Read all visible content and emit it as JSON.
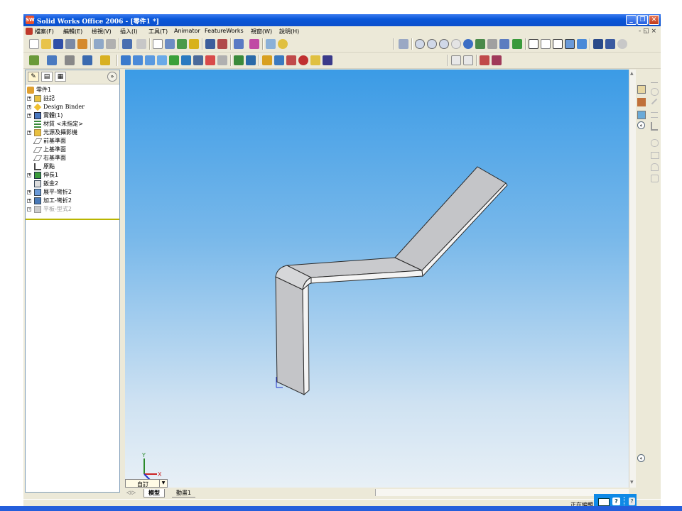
{
  "window": {
    "title": "Solid Works Office 2006 - [零件1 *]",
    "app_icon": "SW",
    "controls": {
      "minimize": "_",
      "restore": "❐",
      "close": "✕"
    },
    "doc_controls": "- ◱ ×"
  },
  "menu": {
    "items": [
      "檔案(F)",
      "編輯(E)",
      "檢視(V)",
      "插入(I)",
      "工具(T)",
      "Animator",
      "FeatureWorks",
      "視窗(W)",
      "說明(H)"
    ]
  },
  "feature_manager": {
    "tabs": [
      "feature-tree-tab-icon",
      "property-tab-icon",
      "config-tab-icon"
    ],
    "expand": "»",
    "root": "零件1",
    "items": [
      {
        "label": "註記",
        "expander": "+",
        "icon": "annotation-icon"
      },
      {
        "label": "Design Binder",
        "expander": "+",
        "icon": "binder-icon"
      },
      {
        "label": "實體(1)",
        "expander": "+",
        "icon": "solid-bodies-icon"
      },
      {
        "label": "材質 <未指定>",
        "expander": "",
        "icon": "material-icon"
      },
      {
        "label": "光源及攝影機",
        "expander": "+",
        "icon": "lights-icon"
      },
      {
        "label": "前基準面",
        "expander": "",
        "icon": "plane-icon"
      },
      {
        "label": "上基準面",
        "expander": "",
        "icon": "plane-icon"
      },
      {
        "label": "右基準面",
        "expander": "",
        "icon": "plane-icon"
      },
      {
        "label": "原點",
        "expander": "",
        "icon": "origin-icon"
      },
      {
        "label": "伸長1",
        "expander": "+",
        "icon": "extrude-icon"
      },
      {
        "label": "鈑金2",
        "expander": "",
        "icon": "sheetmetal-icon"
      },
      {
        "label": "展平-彎折2",
        "expander": "+",
        "icon": "flatten-bends-icon"
      },
      {
        "label": "加工-彎折2",
        "expander": "+",
        "icon": "process-bends-icon"
      },
      {
        "label": "平板-型式2",
        "expander": "+",
        "icon": "flat-pattern-icon",
        "suppressed": true
      }
    ]
  },
  "viewport": {
    "view_label": "自訂",
    "triad": {
      "x": "X",
      "y": "Y",
      "z": "Z"
    },
    "gradient_top": "#3b9be6",
    "gradient_bottom": "#e8f0f6"
  },
  "bottom_tabs": {
    "nav": "◁ ▷",
    "tabs": [
      "模型",
      "動畫1"
    ]
  },
  "status": {
    "text": "正在編輯"
  },
  "tray": {
    "help": "?"
  },
  "colors": {
    "title_bar": "#0a57d8",
    "panel": "#ece9d8",
    "part_face": "#c9c9c9",
    "part_edge": "#2a2a2a"
  }
}
